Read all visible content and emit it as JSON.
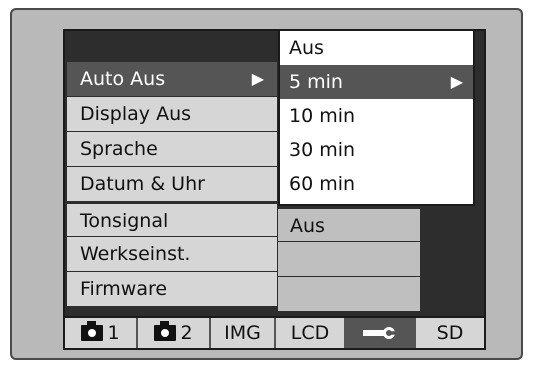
{
  "menu": {
    "items": [
      {
        "label": "Auto Aus",
        "selected": true,
        "arrow": "▶"
      },
      {
        "label": "Display Aus",
        "selected": false
      },
      {
        "label": "Sprache",
        "selected": false
      },
      {
        "label": "Datum & Uhr",
        "selected": false
      },
      {
        "label": "Tonsignal",
        "selected": false
      },
      {
        "label": "Werkseinst.",
        "selected": false
      },
      {
        "label": "Firmware",
        "selected": false
      }
    ],
    "values": {
      "tonsignal": "Aus",
      "werkseinst": "",
      "firmware": ""
    }
  },
  "dropdown": {
    "options": [
      {
        "label": "Aus",
        "selected": false
      },
      {
        "label": "5 min",
        "selected": true,
        "arrow": "▶"
      },
      {
        "label": "10 min",
        "selected": false
      },
      {
        "label": "30 min",
        "selected": false
      },
      {
        "label": "60 min",
        "selected": false
      }
    ]
  },
  "tabs": [
    {
      "label": "1",
      "icon": "camera-icon",
      "selected": false
    },
    {
      "label": "2",
      "icon": "camera-icon",
      "selected": false
    },
    {
      "label": "IMG",
      "selected": false
    },
    {
      "label": "LCD",
      "selected": false
    },
    {
      "label": "",
      "icon": "wrench-icon",
      "selected": true
    },
    {
      "label": "SD",
      "selected": false
    }
  ],
  "colors": {
    "selected_bg": "#555555",
    "row_bg": "#d6d6d6",
    "screen_bg": "#2d2d2d"
  }
}
